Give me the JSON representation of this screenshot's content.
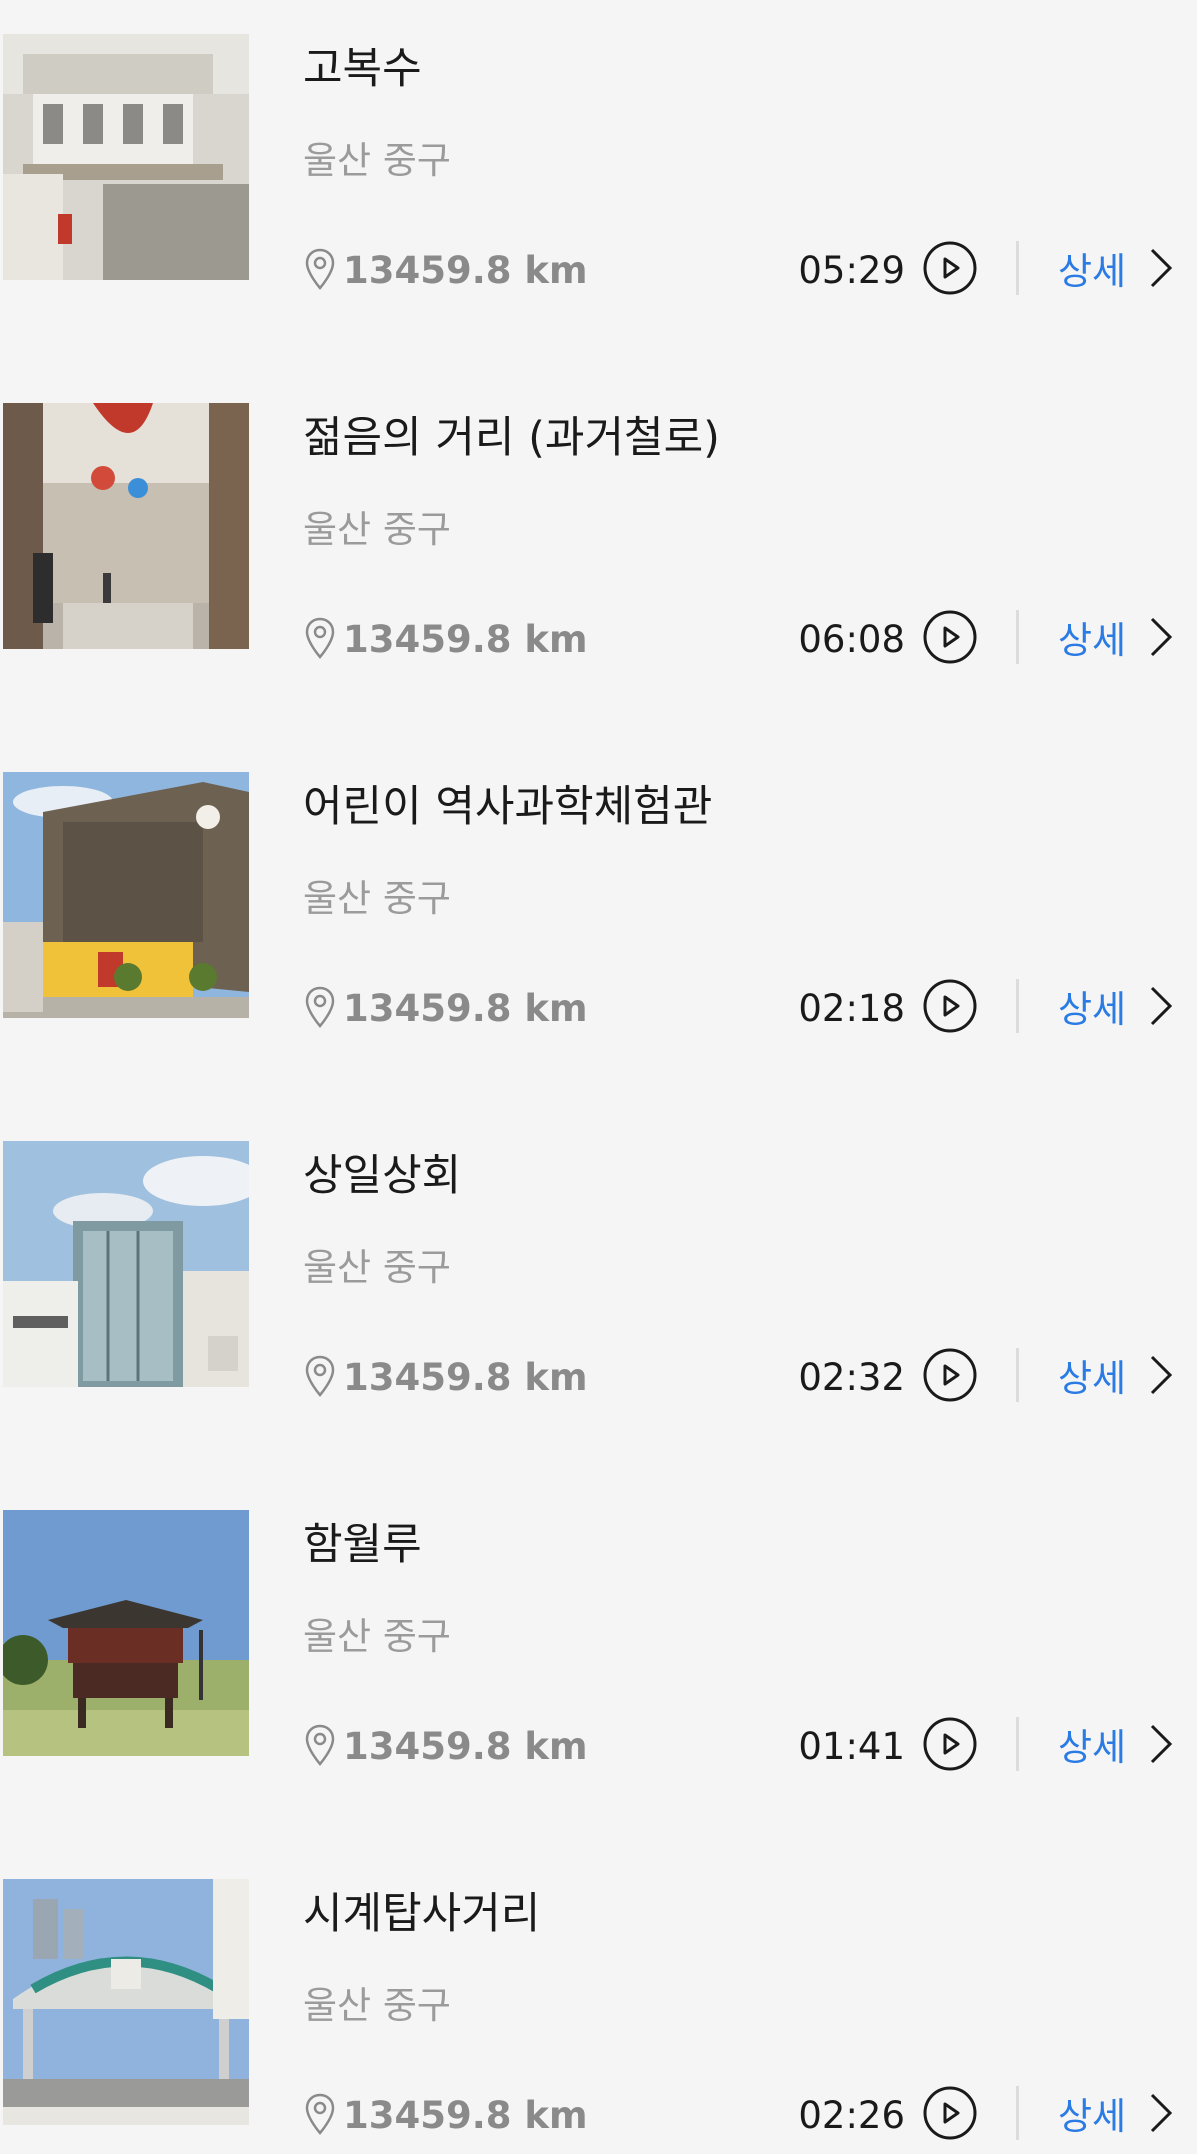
{
  "items": [
    {
      "title": "고복수",
      "region": "울산 중구",
      "distance": "13459.8 km",
      "duration": "05:29",
      "detail": "상세"
    },
    {
      "title": "젊음의 거리 (과거철로)",
      "region": "울산 중구",
      "distance": "13459.8 km",
      "duration": "06:08",
      "detail": "상세"
    },
    {
      "title": "어린이 역사과학체험관",
      "region": "울산 중구",
      "distance": "13459.8 km",
      "duration": "02:18",
      "detail": "상세"
    },
    {
      "title": "상일상회",
      "region": "울산 중구",
      "distance": "13459.8 km",
      "duration": "02:32",
      "detail": "상세"
    },
    {
      "title": "함월루",
      "region": "울산 중구",
      "distance": "13459.8 km",
      "duration": "01:41",
      "detail": "상세"
    },
    {
      "title": "시계탑사거리",
      "region": "울산 중구",
      "distance": "13459.8 km",
      "duration": "02:26",
      "detail": "상세"
    }
  ],
  "icons": {
    "location": "location-pin-icon",
    "play": "play-circle-icon",
    "chevron": "chevron-right-icon"
  },
  "colors": {
    "background": "#f5f5f5",
    "title": "#1a1a1a",
    "muted": "#9b9b9b",
    "accent": "#2a7be4",
    "separator": "#dcdcdc"
  }
}
